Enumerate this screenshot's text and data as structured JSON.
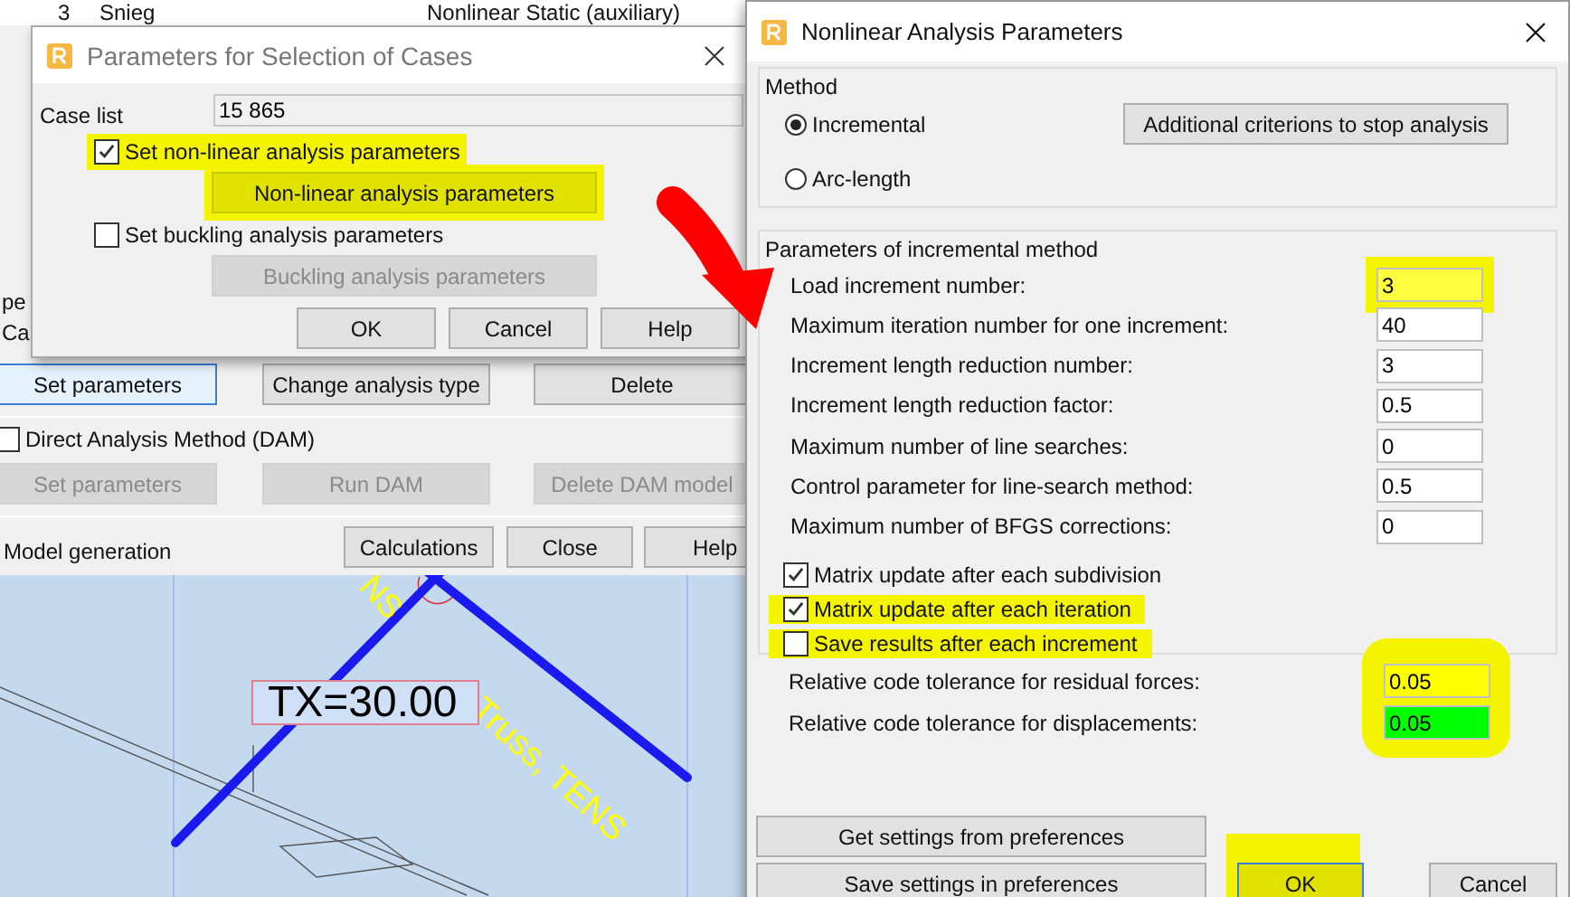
{
  "background_window": {
    "header_row": [
      "3",
      "Snieg",
      "Nonlinear Static (auxiliary)"
    ],
    "edge_texts": [
      "pe",
      "Ca"
    ],
    "buttons": [
      {
        "label": "Set parameters",
        "disabled": false
      },
      {
        "label": "Change analysis type",
        "disabled": false
      },
      {
        "label": "Delete",
        "disabled": false
      }
    ],
    "dam": {
      "label": "Direct Analysis Method (DAM)",
      "checked": false,
      "buttons": [
        {
          "label": "Set parameters",
          "disabled": true
        },
        {
          "label": "Run DAM",
          "disabled": true
        },
        {
          "label": "Delete DAM model",
          "disabled": true
        }
      ]
    },
    "footer": {
      "label": "Model generation",
      "buttons": [
        "Calculations",
        "Close",
        "Help"
      ]
    }
  },
  "viewport": {
    "load_label": "TX=30.00",
    "member_labels": [
      "NS",
      "Truss, TENS"
    ]
  },
  "case_dialog": {
    "title": "Parameters for Selection of Cases",
    "case_list_label": "Case list",
    "case_list_value": "15 865",
    "options": [
      {
        "label": "Set non-linear analysis parameters",
        "checked": true,
        "highlighted": true,
        "button": {
          "label": "Non-linear analysis parameters",
          "disabled": false,
          "highlighted": true
        }
      },
      {
        "label": "Set buckling analysis parameters",
        "checked": false,
        "highlighted": false,
        "button": {
          "label": "Buckling analysis parameters",
          "disabled": true,
          "highlighted": false
        }
      }
    ],
    "buttons": [
      "OK",
      "Cancel",
      "Help"
    ]
  },
  "nonlinear_dialog": {
    "title": "Nonlinear Analysis Parameters",
    "method": {
      "label": "Method",
      "options": [
        {
          "label": "Incremental",
          "selected": true
        },
        {
          "label": "Arc-length",
          "selected": false
        }
      ],
      "button": "Additional criterions to stop analysis"
    },
    "incremental": {
      "label": "Parameters of incremental method",
      "params": [
        {
          "label": "Load increment number:",
          "value": "3",
          "highlighted": true
        },
        {
          "label": "Maximum iteration number for one increment:",
          "value": "40",
          "highlighted": false
        },
        {
          "label": "Increment length reduction number:",
          "value": "3",
          "highlighted": false
        },
        {
          "label": "Increment length reduction factor:",
          "value": "0.5",
          "highlighted": false
        },
        {
          "label": "Maximum number of line searches:",
          "value": "0",
          "highlighted": false
        },
        {
          "label": "Control parameter for line-search method:",
          "value": "0.5",
          "highlighted": false
        },
        {
          "label": "Maximum number of BFGS corrections:",
          "value": "0",
          "highlighted": false
        }
      ],
      "checks": [
        {
          "label": "Matrix update after each subdivision",
          "checked": true,
          "highlighted": false
        },
        {
          "label": "Matrix update after each iteration",
          "checked": true,
          "highlighted": true
        },
        {
          "label": "Save results after each increment",
          "checked": false,
          "highlighted": true
        }
      ]
    },
    "tolerances": {
      "highlighted": true,
      "rows": [
        {
          "label": "Relative code tolerance for residual forces:",
          "value": "0.05",
          "color": "#ffff00"
        },
        {
          "label": "Relative code tolerance for displacements:",
          "value": "0.05",
          "color": "#00ff00"
        }
      ]
    },
    "preference_buttons": [
      "Get settings from preferences",
      "Save settings in preferences"
    ],
    "ok": {
      "label": "OK",
      "highlighted": true
    },
    "cancel": "Cancel"
  }
}
